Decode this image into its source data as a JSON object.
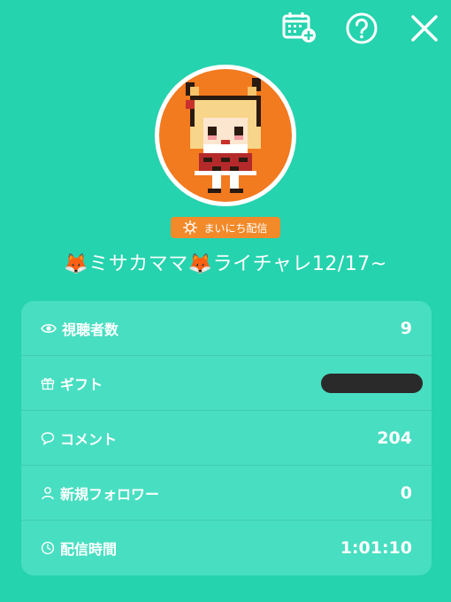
{
  "header": {
    "calendar_icon": "calendar-add-icon",
    "help_icon": "help-circle-icon",
    "close_icon": "close-icon"
  },
  "profile": {
    "badge_label": "まいにち配信",
    "title": "🦊ミサカママ🦊ライチャレ12/17~"
  },
  "stats": [
    {
      "icon": "eye-icon",
      "label": "視聴者数",
      "value": "9"
    },
    {
      "icon": "gift-icon",
      "label": "ギフト",
      "value": ""
    },
    {
      "icon": "comment-icon",
      "label": "コメント",
      "value": "204"
    },
    {
      "icon": "person-icon",
      "label": "新規フォロワー",
      "value": "0"
    },
    {
      "icon": "clock-icon",
      "label": "配信時間",
      "value": "1:01:10"
    }
  ],
  "colors": {
    "background": "#25d3ae",
    "panel": "#48dec1",
    "badge": "#f28a2a",
    "avatar_bg": "#f27a1f"
  }
}
